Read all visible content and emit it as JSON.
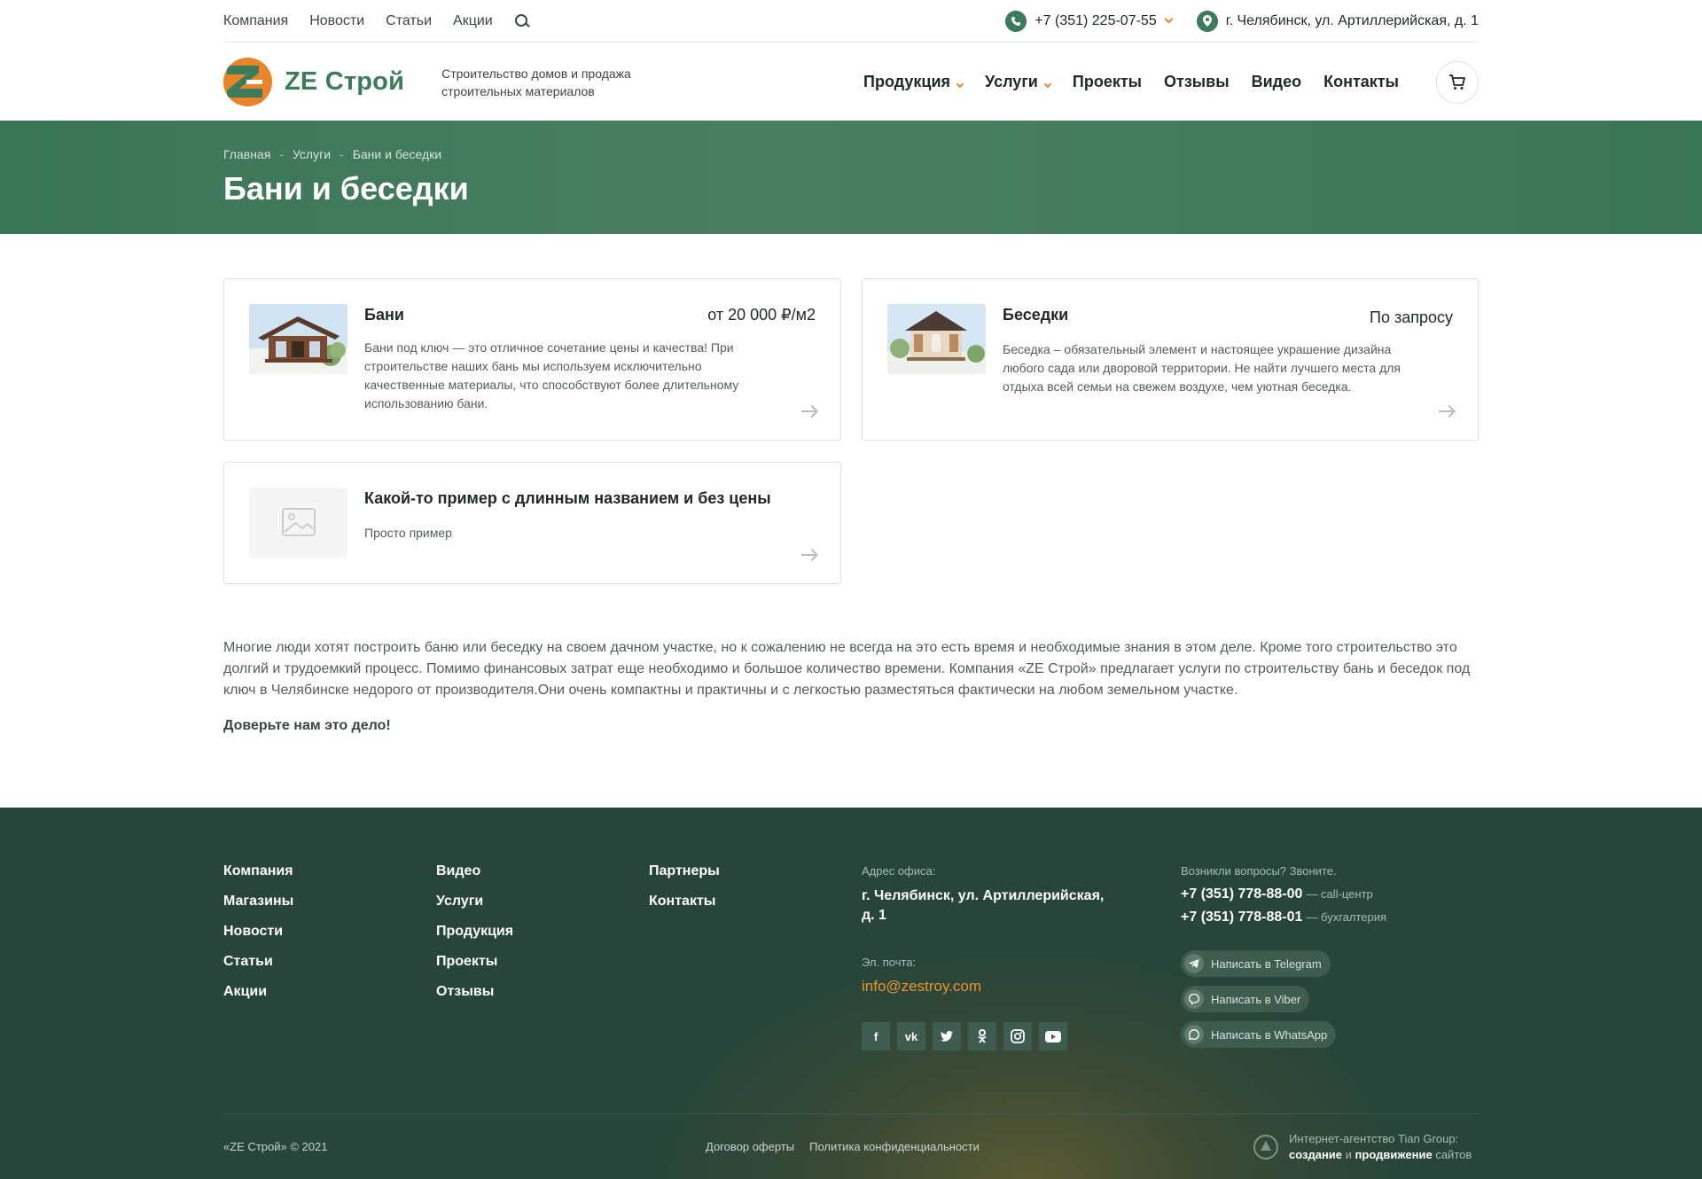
{
  "topbar": {
    "links": [
      "Компания",
      "Новости",
      "Статьи",
      "Акции"
    ],
    "phone": "+7 (351) 225-07-55",
    "address": "г. Челябинск, ул. Артиллерийская, д. 1"
  },
  "header": {
    "logo_text": "ZE Строй",
    "tagline": "Строительство домов и продажа строительных материалов",
    "nav": [
      "Продукция",
      "Услуги",
      "Проекты",
      "Отзывы",
      "Видео",
      "Контакты"
    ]
  },
  "banner": {
    "breadcrumbs": [
      "Главная",
      "Услуги",
      "Бани и беседки"
    ],
    "title": "Бани и беседки"
  },
  "cards": [
    {
      "title": "Бани",
      "price": "от 20 000  ₽/м2",
      "desc": "Бани под ключ — это отличное сочетание цены и качества! При строительстве наших бань мы используем исключительно качественные материалы, что способствуют более длительному использованию бани."
    },
    {
      "title": "Беседки",
      "price": "По запросу",
      "desc": "Беседка – обязательный элемент и настоящее украшение дизайна любого сада или дворовой территории. Не найти лучшего места для отдыха всей семьи на свежем воздухе, чем уютная беседка."
    },
    {
      "title": "Какой-то пример с длинным названием и без цены",
      "price": "",
      "desc": "Просто пример"
    }
  ],
  "seo": {
    "text": "Многие люди хотят построить баню или беседку на своем дачном участке, но к сожалению не всегда на это есть время и необходимые знания в этом деле. Кроме того строительство это долгий и трудоемкий процесс. Помимо финансовых затрат еще необходимо и большое количество времени. Компания «ZE Строй» предлагает услуги по строительству бань и беседок под ключ в Челябинске недорого от производителя.Они очень компактны и практичны и с легкостью разместяться фактически на любом земельном участке.",
    "bold": "Доверьте нам это дело!"
  },
  "footer": {
    "col1": [
      "Компания",
      "Магазины",
      "Новости",
      "Статьи",
      "Акции"
    ],
    "col2": [
      "Видео",
      "Услуги",
      "Продукция",
      "Проекты",
      "Отзывы"
    ],
    "col3": [
      "Партнеры",
      "Контакты"
    ],
    "address_label": "Адрес офиса:",
    "address": "г. Челябинск, ул. Артиллерийская, д. 1",
    "email_label": "Эл. почта:",
    "email": "info@zestroy.com",
    "social": [
      "facebook-icon",
      "vk-icon",
      "twitter-icon",
      "odnoklassniki-icon",
      "instagram-icon",
      "youtube-icon"
    ],
    "phones_label": "Возникли вопросы? Звоните.",
    "phone1": "+7 (351) 778-88-00",
    "phone1_note": "— call-центр",
    "phone2": "+7 (351) 778-88-01",
    "phone2_note": "— бухгалтерия",
    "messengers": [
      "Написать в Telegram",
      "Написать в Viber",
      "Написать в WhatsApp"
    ],
    "copyright": "«ZE Строй» © 2021",
    "legal": [
      "Договор оферты",
      "Политика конфиденциальности"
    ],
    "agency_line1": "Интернет-агентство Tian Group:",
    "agency_create": "создание",
    "agency_and": "и",
    "agency_promo": "продвижение",
    "agency_sites": "сайтов"
  },
  "colors": {
    "brand_green": "#3e7a5c",
    "accent_orange": "#e8852b",
    "footer_bg": "#27453a"
  }
}
